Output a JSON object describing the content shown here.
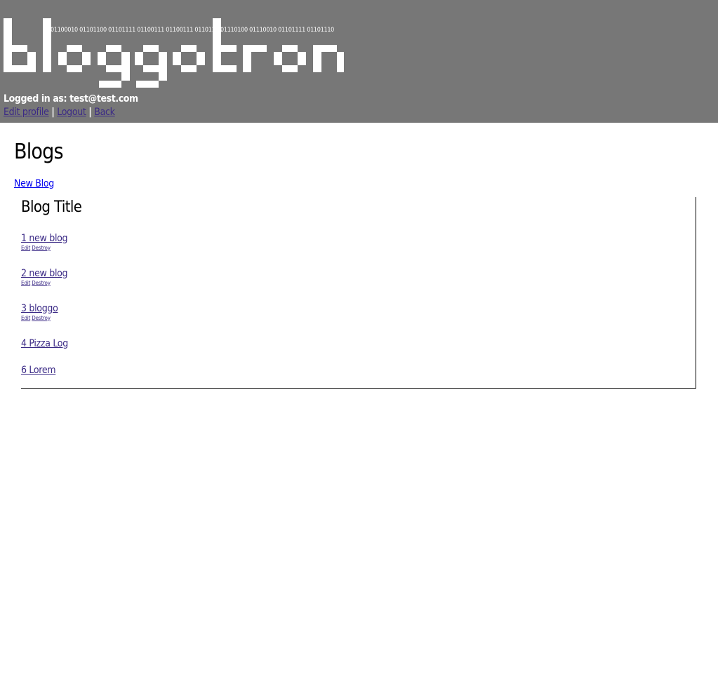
{
  "header": {
    "logo_text": "bloggotron",
    "binary_left": "01100010 01101100 01101111 01100111 01100111 01101111",
    "binary_right": "01110100 01110010 01101111 01101110",
    "logged_in_label": "Logged in as: test@test.com",
    "nav": {
      "edit_profile": "Edit profile",
      "separator": "|",
      "logout": "Logout",
      "back": "Back"
    }
  },
  "main": {
    "title": "Blogs",
    "new_blog_label": "New Blog",
    "blog_list": {
      "heading": "Blog Title",
      "edit_label": "Edit",
      "destroy_label": "Destroy",
      "items": [
        {
          "title": "1 new blog",
          "has_actions": true
        },
        {
          "title": "2 new blog",
          "has_actions": true
        },
        {
          "title": "3 bloggo",
          "has_actions": true
        },
        {
          "title": "4 Pizza Log",
          "has_actions": false
        },
        {
          "title": "6 Lorem",
          "has_actions": false
        }
      ]
    }
  },
  "colors": {
    "header_bg": "#777777",
    "logo_fg": "#ffffff",
    "link": "#3b2a86",
    "new_blog_link": "#0000ee"
  },
  "icons": {
    "logo": "pixel-logo-icon"
  }
}
